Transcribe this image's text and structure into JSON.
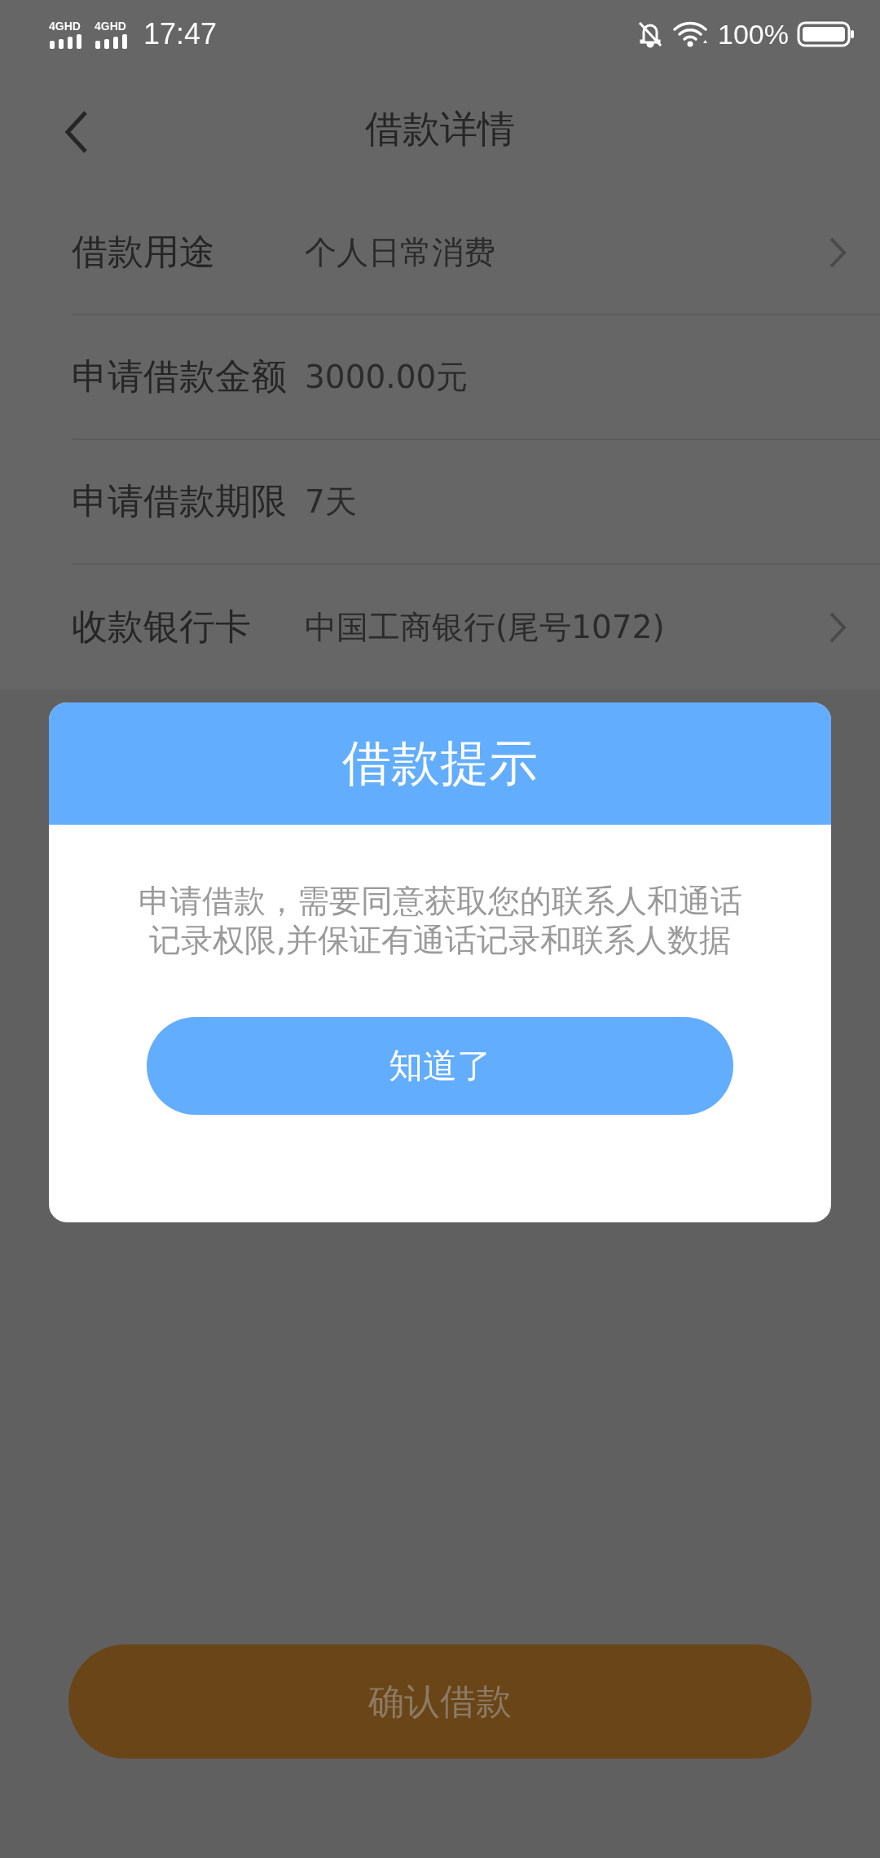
{
  "status_bar": {
    "networks": [
      "4GHD",
      "4GHD"
    ],
    "time": "17:47",
    "battery": "100%"
  },
  "header": {
    "title": "借款详情"
  },
  "rows": [
    {
      "label": "借款用途",
      "value": "个人日常消费",
      "has_arrow": true
    },
    {
      "label": "申请借款金额",
      "value": "3000.00元",
      "has_arrow": false
    },
    {
      "label": "申请借款期限",
      "value": "7天",
      "has_arrow": false
    },
    {
      "label": "收款银行卡",
      "value": "中国工商银行(尾号1072)",
      "has_arrow": true
    }
  ],
  "dialog": {
    "title": "借款提示",
    "message": "申请借款，需要同意获取您的联系人和通话记录权限,并保证有通话记录和联系人数据",
    "button": "知道了"
  },
  "confirm_button": {
    "label": "确认借款"
  }
}
